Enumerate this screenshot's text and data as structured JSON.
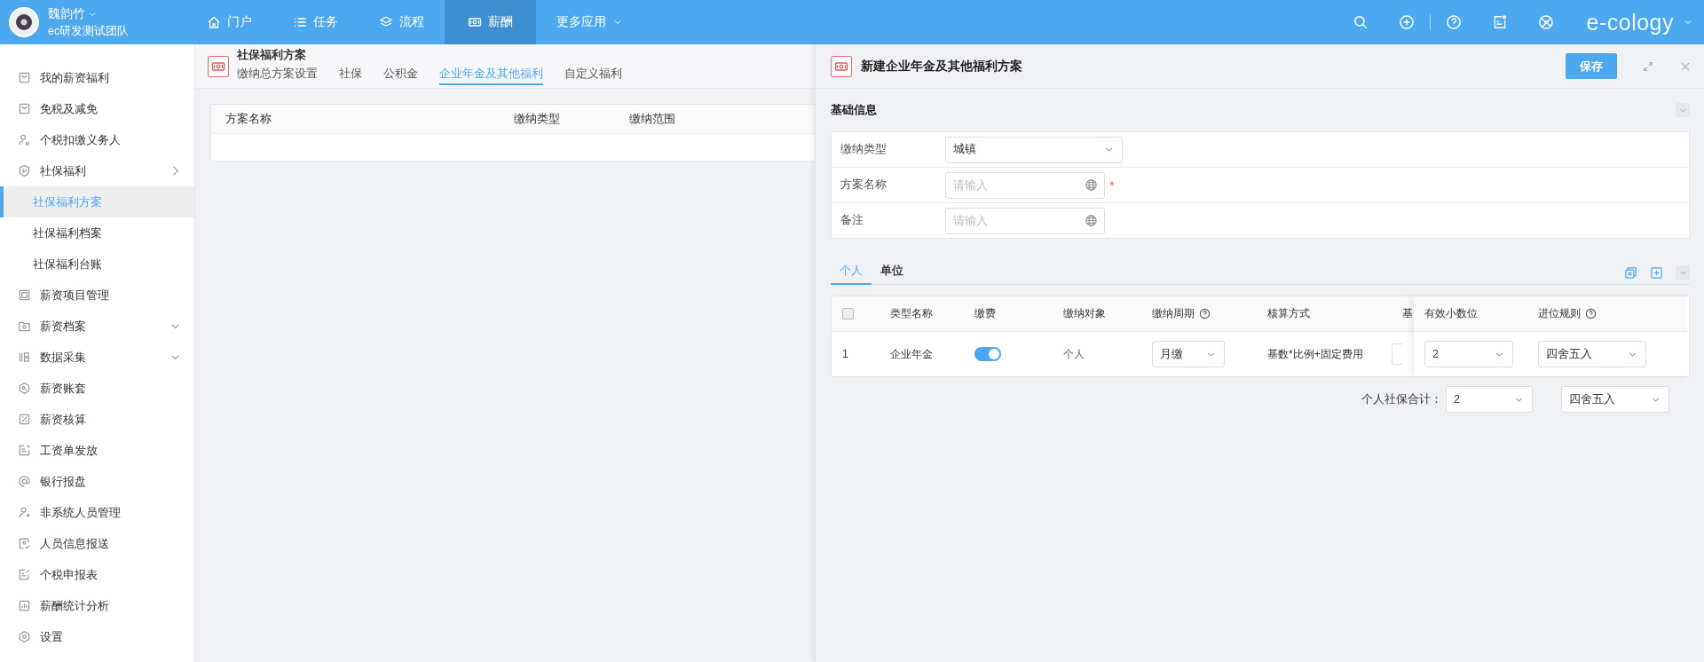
{
  "user": {
    "name": "魏韵竹",
    "team": "ec研发测试团队"
  },
  "nav": [
    {
      "label": "门户",
      "selected": false
    },
    {
      "label": "任务",
      "selected": false
    },
    {
      "label": "流程",
      "selected": false
    },
    {
      "label": "薪酬",
      "selected": true
    },
    {
      "label": "更多应用",
      "selected": false
    }
  ],
  "brand": "e-cology",
  "sidebar": {
    "items": [
      {
        "label": "我的薪资福利",
        "selected": false
      },
      {
        "label": "免税及减免",
        "selected": false
      },
      {
        "label": "个税扣缴义务人",
        "selected": false
      },
      {
        "label": "社保福利",
        "selected": false,
        "expanded": true,
        "children": [
          {
            "label": "社保福利方案",
            "selected": true
          },
          {
            "label": "社保福利档案",
            "selected": false
          },
          {
            "label": "社保福利台账",
            "selected": false
          }
        ]
      },
      {
        "label": "薪资项目管理",
        "selected": false
      },
      {
        "label": "薪资档案",
        "selected": false,
        "expanded": false
      },
      {
        "label": "数据采集",
        "selected": false,
        "expanded": false
      },
      {
        "label": "薪资账套",
        "selected": false
      },
      {
        "label": "薪资核算",
        "selected": false
      },
      {
        "label": "工资单发放",
        "selected": false
      },
      {
        "label": "银行报盘",
        "selected": false
      },
      {
        "label": "非系统人员管理",
        "selected": false
      },
      {
        "label": "人员信息报送",
        "selected": false
      },
      {
        "label": "个税申报表",
        "selected": false
      },
      {
        "label": "薪酬统计分析",
        "selected": false
      },
      {
        "label": "设置",
        "selected": false
      }
    ]
  },
  "page": {
    "title": "社保福利方案",
    "tabs": [
      {
        "label": "缴纳总方案设置",
        "selected": false
      },
      {
        "label": "社保",
        "selected": false
      },
      {
        "label": "公积金",
        "selected": false
      },
      {
        "label": "企业年金及其他福利",
        "selected": true
      },
      {
        "label": "自定义福利",
        "selected": false
      }
    ],
    "table": {
      "columns": [
        "方案名称",
        "缴纳类型",
        "缴纳范围"
      ]
    }
  },
  "drawer": {
    "title": "新建企业年金及其他福利方案",
    "save": "保存",
    "section": "基础信息",
    "fields": [
      {
        "label": "缴纳类型",
        "kind": "select",
        "value": "城镇"
      },
      {
        "label": "方案名称",
        "kind": "text",
        "placeholder": "请输入",
        "required_mark": "*"
      },
      {
        "label": "备注",
        "kind": "text",
        "placeholder": "请输入"
      }
    ],
    "tabs": [
      {
        "label": "个人",
        "selected": true
      },
      {
        "label": "单位",
        "selected": false
      }
    ],
    "table": {
      "select_all": {
        "checked": false
      },
      "columns": [
        {
          "label": "类型名称",
          "help": false
        },
        {
          "label": "缴费",
          "help": false
        },
        {
          "label": "缴纳对象",
          "help": false
        },
        {
          "label": "缴纳周期",
          "help": true
        },
        {
          "label": "核算方式",
          "help": false
        },
        {
          "label": "基",
          "help": false
        },
        {
          "label": "有效小数位",
          "help": false
        },
        {
          "label": "进位规则",
          "help": true
        }
      ],
      "rows": [
        {
          "index": "1",
          "name": "企业年金",
          "on": true,
          "target": "个人",
          "period": "月缴",
          "method": "基数*比例+固定费用",
          "decimals": "2",
          "rounding": "四舍五入"
        }
      ]
    },
    "total": {
      "label": "个人社保合计：",
      "decimals": "2",
      "rounding": "四舍五入"
    }
  }
}
